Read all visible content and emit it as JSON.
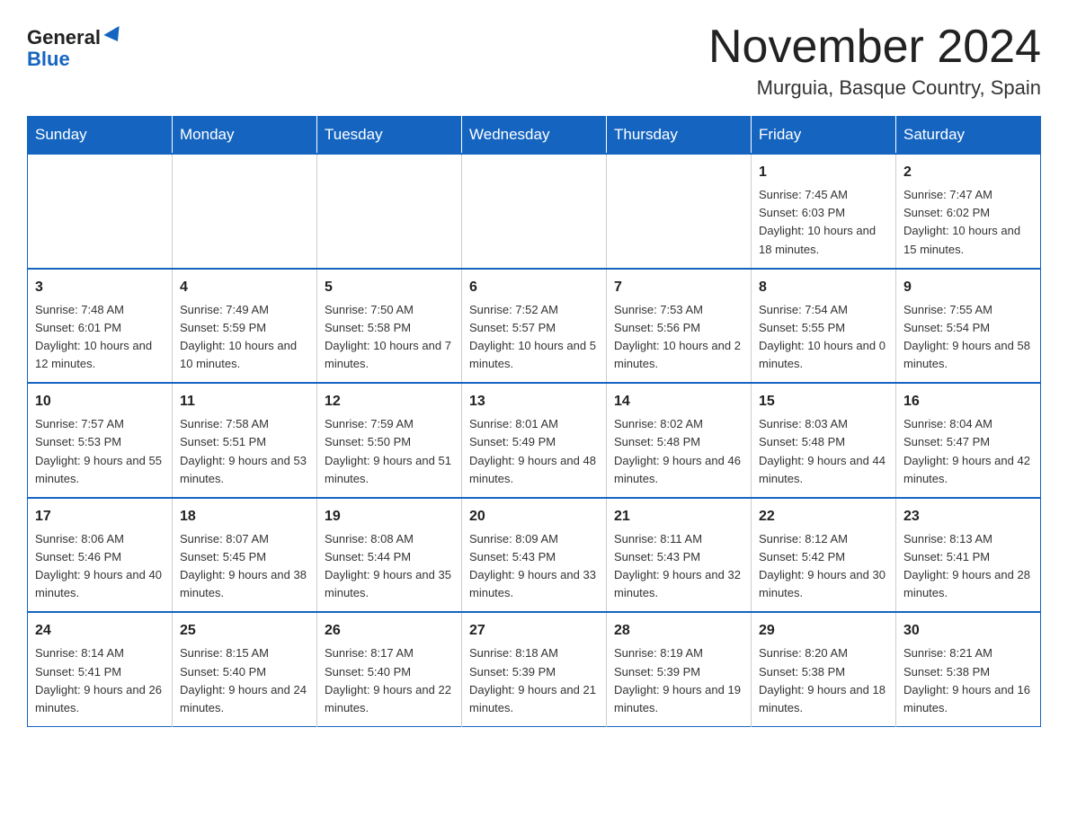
{
  "logo": {
    "general": "General",
    "blue": "Blue",
    "triangle_label": "logo-triangle"
  },
  "title": "November 2024",
  "subtitle": "Murguia, Basque Country, Spain",
  "header": {
    "colors": {
      "primary": "#1565c0"
    }
  },
  "weekdays": [
    "Sunday",
    "Monday",
    "Tuesday",
    "Wednesday",
    "Thursday",
    "Friday",
    "Saturday"
  ],
  "weeks": [
    [
      {
        "day": "",
        "info": ""
      },
      {
        "day": "",
        "info": ""
      },
      {
        "day": "",
        "info": ""
      },
      {
        "day": "",
        "info": ""
      },
      {
        "day": "",
        "info": ""
      },
      {
        "day": "1",
        "info": "Sunrise: 7:45 AM\nSunset: 6:03 PM\nDaylight: 10 hours\nand 18 minutes."
      },
      {
        "day": "2",
        "info": "Sunrise: 7:47 AM\nSunset: 6:02 PM\nDaylight: 10 hours\nand 15 minutes."
      }
    ],
    [
      {
        "day": "3",
        "info": "Sunrise: 7:48 AM\nSunset: 6:01 PM\nDaylight: 10 hours\nand 12 minutes."
      },
      {
        "day": "4",
        "info": "Sunrise: 7:49 AM\nSunset: 5:59 PM\nDaylight: 10 hours\nand 10 minutes."
      },
      {
        "day": "5",
        "info": "Sunrise: 7:50 AM\nSunset: 5:58 PM\nDaylight: 10 hours\nand 7 minutes."
      },
      {
        "day": "6",
        "info": "Sunrise: 7:52 AM\nSunset: 5:57 PM\nDaylight: 10 hours\nand 5 minutes."
      },
      {
        "day": "7",
        "info": "Sunrise: 7:53 AM\nSunset: 5:56 PM\nDaylight: 10 hours\nand 2 minutes."
      },
      {
        "day": "8",
        "info": "Sunrise: 7:54 AM\nSunset: 5:55 PM\nDaylight: 10 hours\nand 0 minutes."
      },
      {
        "day": "9",
        "info": "Sunrise: 7:55 AM\nSunset: 5:54 PM\nDaylight: 9 hours\nand 58 minutes."
      }
    ],
    [
      {
        "day": "10",
        "info": "Sunrise: 7:57 AM\nSunset: 5:53 PM\nDaylight: 9 hours\nand 55 minutes."
      },
      {
        "day": "11",
        "info": "Sunrise: 7:58 AM\nSunset: 5:51 PM\nDaylight: 9 hours\nand 53 minutes."
      },
      {
        "day": "12",
        "info": "Sunrise: 7:59 AM\nSunset: 5:50 PM\nDaylight: 9 hours\nand 51 minutes."
      },
      {
        "day": "13",
        "info": "Sunrise: 8:01 AM\nSunset: 5:49 PM\nDaylight: 9 hours\nand 48 minutes."
      },
      {
        "day": "14",
        "info": "Sunrise: 8:02 AM\nSunset: 5:48 PM\nDaylight: 9 hours\nand 46 minutes."
      },
      {
        "day": "15",
        "info": "Sunrise: 8:03 AM\nSunset: 5:48 PM\nDaylight: 9 hours\nand 44 minutes."
      },
      {
        "day": "16",
        "info": "Sunrise: 8:04 AM\nSunset: 5:47 PM\nDaylight: 9 hours\nand 42 minutes."
      }
    ],
    [
      {
        "day": "17",
        "info": "Sunrise: 8:06 AM\nSunset: 5:46 PM\nDaylight: 9 hours\nand 40 minutes."
      },
      {
        "day": "18",
        "info": "Sunrise: 8:07 AM\nSunset: 5:45 PM\nDaylight: 9 hours\nand 38 minutes."
      },
      {
        "day": "19",
        "info": "Sunrise: 8:08 AM\nSunset: 5:44 PM\nDaylight: 9 hours\nand 35 minutes."
      },
      {
        "day": "20",
        "info": "Sunrise: 8:09 AM\nSunset: 5:43 PM\nDaylight: 9 hours\nand 33 minutes."
      },
      {
        "day": "21",
        "info": "Sunrise: 8:11 AM\nSunset: 5:43 PM\nDaylight: 9 hours\nand 32 minutes."
      },
      {
        "day": "22",
        "info": "Sunrise: 8:12 AM\nSunset: 5:42 PM\nDaylight: 9 hours\nand 30 minutes."
      },
      {
        "day": "23",
        "info": "Sunrise: 8:13 AM\nSunset: 5:41 PM\nDaylight: 9 hours\nand 28 minutes."
      }
    ],
    [
      {
        "day": "24",
        "info": "Sunrise: 8:14 AM\nSunset: 5:41 PM\nDaylight: 9 hours\nand 26 minutes."
      },
      {
        "day": "25",
        "info": "Sunrise: 8:15 AM\nSunset: 5:40 PM\nDaylight: 9 hours\nand 24 minutes."
      },
      {
        "day": "26",
        "info": "Sunrise: 8:17 AM\nSunset: 5:40 PM\nDaylight: 9 hours\nand 22 minutes."
      },
      {
        "day": "27",
        "info": "Sunrise: 8:18 AM\nSunset: 5:39 PM\nDaylight: 9 hours\nand 21 minutes."
      },
      {
        "day": "28",
        "info": "Sunrise: 8:19 AM\nSunset: 5:39 PM\nDaylight: 9 hours\nand 19 minutes."
      },
      {
        "day": "29",
        "info": "Sunrise: 8:20 AM\nSunset: 5:38 PM\nDaylight: 9 hours\nand 18 minutes."
      },
      {
        "day": "30",
        "info": "Sunrise: 8:21 AM\nSunset: 5:38 PM\nDaylight: 9 hours\nand 16 minutes."
      }
    ]
  ]
}
